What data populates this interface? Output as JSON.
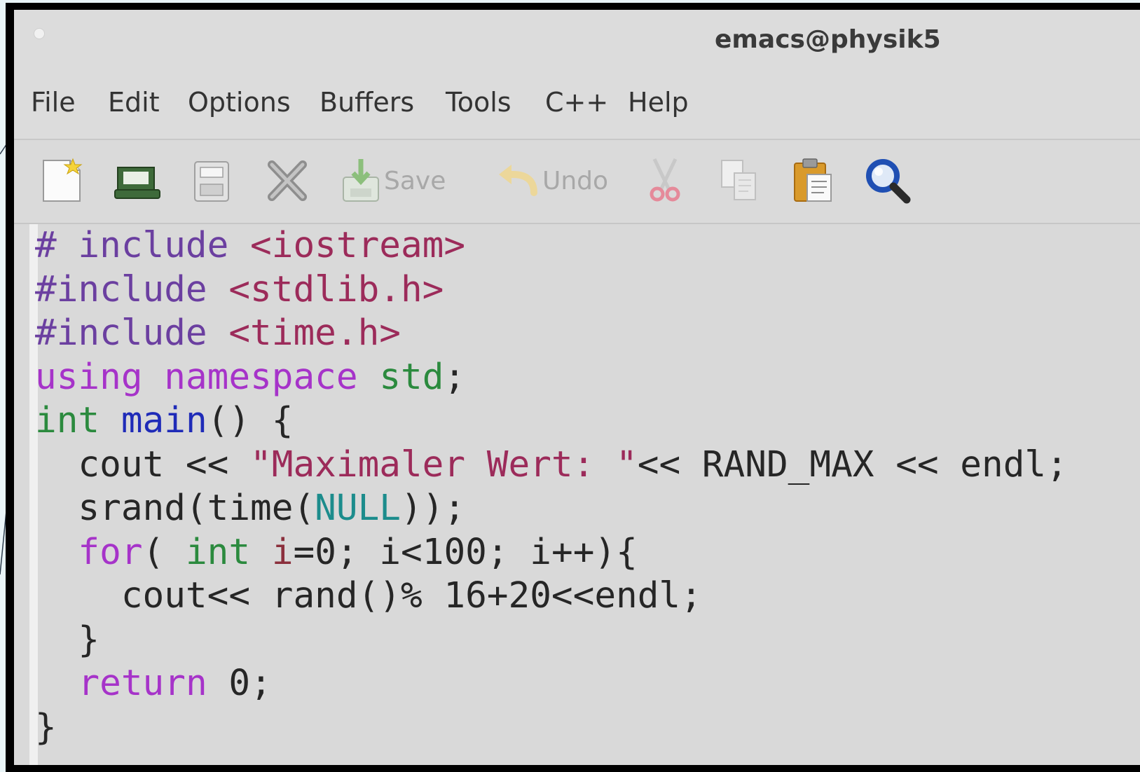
{
  "window": {
    "title": "emacs@physik5"
  },
  "menu": [
    "File",
    "Edit",
    "Options",
    "Buffers",
    "Tools",
    "C++",
    "Help"
  ],
  "toolbar": {
    "buttons": [
      {
        "icon": "new-file-icon"
      },
      {
        "icon": "open-folder-icon"
      },
      {
        "icon": "save-disk-icon"
      },
      {
        "icon": "close-x-icon"
      },
      {
        "icon": "save-icon",
        "label": "Save"
      },
      {
        "icon": "undo-icon",
        "label": "Undo"
      },
      {
        "icon": "cut-icon"
      },
      {
        "icon": "copy-icon"
      },
      {
        "icon": "paste-icon"
      },
      {
        "icon": "search-icon"
      }
    ]
  },
  "code": {
    "lines": [
      [
        [
          "pre",
          "# include "
        ],
        [
          "str",
          "<iostream>"
        ]
      ],
      [
        [
          "pre",
          "#include "
        ],
        [
          "str",
          "<stdlib.h>"
        ]
      ],
      [
        [
          "pre",
          "#include "
        ],
        [
          "str",
          "<time.h>"
        ]
      ],
      [
        [
          "kw",
          "using"
        ],
        [
          "plain",
          " "
        ],
        [
          "kw",
          "namespace"
        ],
        [
          "plain",
          " "
        ],
        [
          "type",
          "std"
        ],
        [
          "plain",
          ";"
        ]
      ],
      [
        [
          "type",
          "int"
        ],
        [
          "plain",
          " "
        ],
        [
          "fn",
          "main"
        ],
        [
          "plain",
          "() {"
        ]
      ],
      [
        [
          "plain",
          "  cout << "
        ],
        [
          "str",
          "\"Maximaler Wert: \""
        ],
        [
          "plain",
          "<< RAND_MAX << endl;"
        ]
      ],
      [
        [
          "plain",
          "  srand(time("
        ],
        [
          "const",
          "NULL"
        ],
        [
          "plain",
          "));"
        ]
      ],
      [
        [
          "plain",
          "  "
        ],
        [
          "kw",
          "for"
        ],
        [
          "plain",
          "( "
        ],
        [
          "type",
          "int"
        ],
        [
          "plain",
          " "
        ],
        [
          "var",
          "i"
        ],
        [
          "plain",
          "=0; i<100; i++){"
        ]
      ],
      [
        [
          "plain",
          "    cout<< rand()% 16+20<<endl;"
        ]
      ],
      [
        [
          "plain",
          "  }"
        ]
      ],
      [
        [
          "plain",
          "  "
        ],
        [
          "kw",
          "return"
        ],
        [
          "plain",
          " 0;"
        ]
      ],
      [
        [
          "plain",
          "}"
        ]
      ]
    ]
  },
  "colors": {
    "preprocessor": "#6b3fa0",
    "string": "#9c2b5a",
    "keyword": "#a633c9",
    "type": "#2b8a3e",
    "function": "#1f2bb8",
    "constant": "#1c8c8c",
    "variable": "#8b2f3c"
  }
}
